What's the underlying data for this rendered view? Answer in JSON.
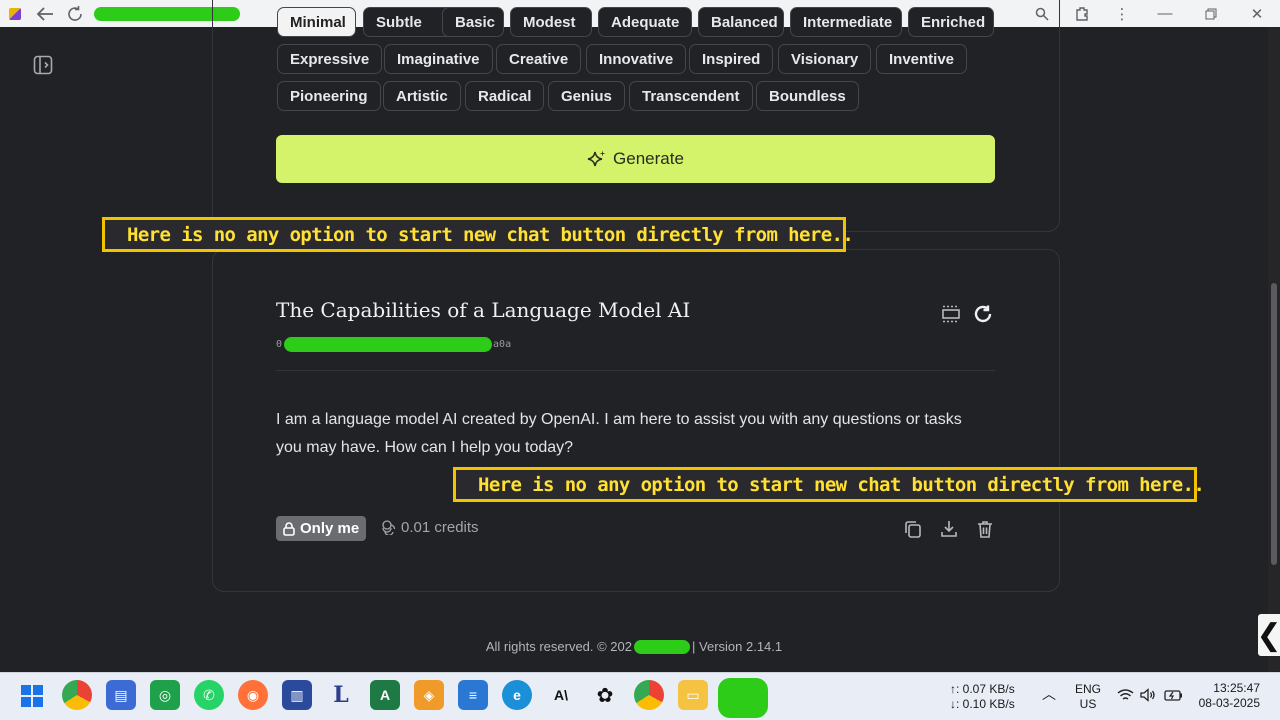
{
  "browser": {
    "tooltip_back": "",
    "title_redacted": true
  },
  "chips_row_top_partial": [
    "Minimal",
    "Subtle",
    "Basic",
    "Modest",
    "Adequate",
    "Balanced",
    "Intermediate",
    "Enriched"
  ],
  "chips_row1": [
    "Expressive",
    "Imaginative",
    "Creative",
    "Innovative",
    "Inspired",
    "Visionary",
    "Inventive"
  ],
  "chips_row2": [
    "Pioneering",
    "Artistic",
    "Radical",
    "Genius",
    "Transcendent",
    "Boundless"
  ],
  "generate": {
    "label": "Generate"
  },
  "annotations": {
    "top": "Here is no any option to start new chat button directly from here..",
    "bottom": "Here is no any option to start new chat button directly from here.."
  },
  "result": {
    "title": "The Capabilities of a Language Model AI",
    "id_prefix": "0",
    "id_suffix": "a0a",
    "body": "I am a language model AI created by OpenAI. I am here to assist you with any questions or tasks you may have. How can I help you today?",
    "visibility": "Only me",
    "credits": "0.01 credits"
  },
  "footer": {
    "rights": "All rights reserved. © 202",
    "version": "| Version 2.14.1"
  },
  "taskbar": {
    "net_up": "↑: 0.07 KB/s",
    "net_down": "↓: 0.10 KB/s",
    "lang1": "ENG",
    "lang2": "US",
    "time": "13:25:47",
    "date": "08-03-2025"
  },
  "colors": {
    "accent_generate": "#d4f26a",
    "annotation_border": "#f2c400",
    "annotation_text": "#ffe033",
    "redaction": "#2ccc18"
  }
}
